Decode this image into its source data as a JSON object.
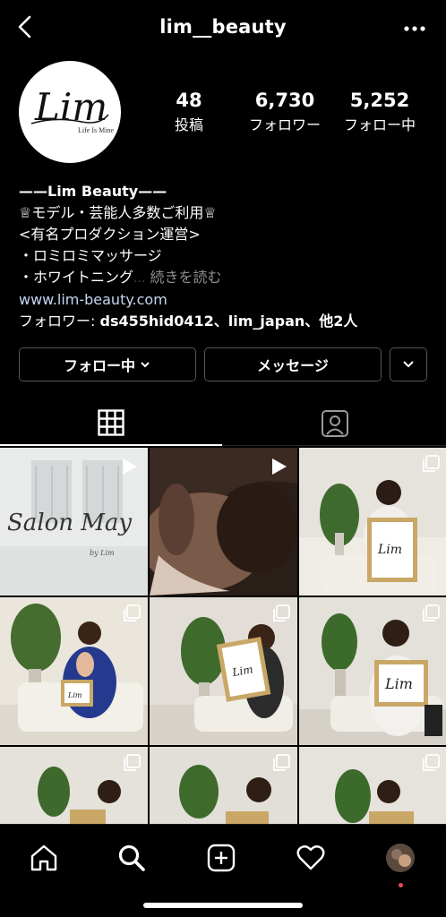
{
  "header": {
    "username": "lim__beauty"
  },
  "avatar": {
    "logo_text": "Lim",
    "tagline": "Life Is Mine"
  },
  "stats": {
    "posts_count": "48",
    "posts_label": "投稿",
    "followers_count": "6,730",
    "followers_label": "フォロワー",
    "following_count": "5,252",
    "following_label": "フォロー中"
  },
  "bio": {
    "name": "——Lim Beauty——",
    "line1": "♕モデル・芸能人多数ご利用♕",
    "line2": "<有名プロダクション運営>",
    "line3": "・ロミロミマッサージ",
    "line4": "・ホワイトニング",
    "line4_faded": "...",
    "more": "続きを読む",
    "website": "www.lim-beauty.com",
    "followed_by_prefix": "フォロワー: ",
    "followed_by_names": "ds455hid0412、lim_japan",
    "followed_by_suffix": "、他2人"
  },
  "buttons": {
    "following": "フォロー中",
    "message": "メッセージ"
  },
  "posts": [
    {
      "caption": "Salon May",
      "sub": "by Lim",
      "type": "video"
    },
    {
      "type": "video"
    },
    {
      "frame_text": "Lim",
      "type": "carousel"
    },
    {
      "frame_text": "Lim",
      "type": "carousel"
    },
    {
      "frame_text": "Lim",
      "type": "carousel"
    },
    {
      "frame_text": "Lim",
      "type": "carousel"
    },
    {
      "type": "carousel"
    },
    {
      "type": "carousel"
    },
    {
      "type": "carousel"
    }
  ],
  "nav": {
    "items": [
      "home-icon",
      "search-icon",
      "new-post-icon",
      "heart-icon",
      "profile-avatar"
    ]
  },
  "colors": {
    "background": "#000000",
    "text": "#ffffff",
    "link": "#c7d5f0",
    "muted": "#8e8e8e",
    "notification": "#ed4956"
  }
}
